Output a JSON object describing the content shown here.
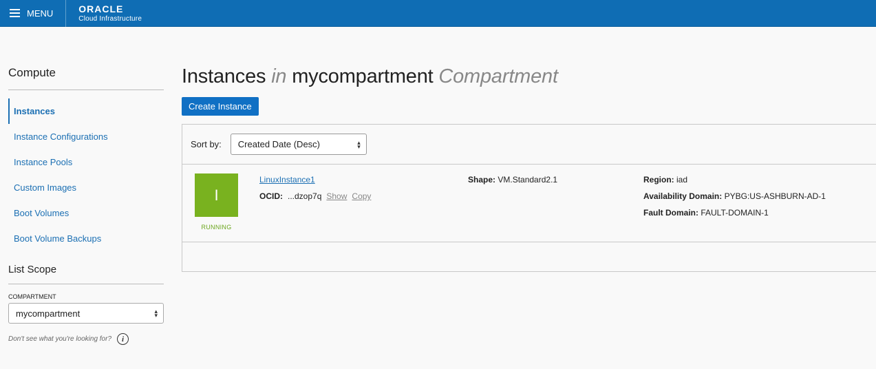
{
  "topbar": {
    "menu_label": "MENU",
    "brand_logo": "ORACLE",
    "brand_sub": "Cloud Infrastructure"
  },
  "sidebar": {
    "heading": "Compute",
    "items": [
      {
        "label": "Instances",
        "active": true
      },
      {
        "label": "Instance Configurations",
        "active": false
      },
      {
        "label": "Instance Pools",
        "active": false
      },
      {
        "label": "Custom Images",
        "active": false
      },
      {
        "label": "Boot Volumes",
        "active": false
      },
      {
        "label": "Boot Volume Backups",
        "active": false
      }
    ],
    "scope_heading": "List Scope",
    "compartment_label": "COMPARTMENT",
    "compartment_value": "mycompartment",
    "help_text": "Don't see what you're looking for?"
  },
  "main": {
    "title_part1": "Instances",
    "title_in": "in",
    "title_compartment": "mycompartment",
    "title_suffix": "Compartment",
    "create_button": "Create Instance",
    "sort_label": "Sort by:",
    "sort_value": "Created Date (Desc)",
    "instances": [
      {
        "initial": "I",
        "status": "RUNNING",
        "name": "LinuxInstance1",
        "ocid_label": "OCID:",
        "ocid_value": "...dzop7q",
        "show_label": "Show",
        "copy_label": "Copy",
        "shape_label": "Shape:",
        "shape_value": "VM.Standard2.1",
        "region_label": "Region:",
        "region_value": "iad",
        "ad_label": "Availability Domain:",
        "ad_value": "PYBG:US-ASHBURN-AD-1",
        "fd_label": "Fault Domain:",
        "fd_value": "FAULT-DOMAIN-1"
      }
    ]
  },
  "colors": {
    "topbar": "#0f6db4",
    "link": "#1b6fb3",
    "primary_button": "#1070c4",
    "running": "#79b21f"
  }
}
